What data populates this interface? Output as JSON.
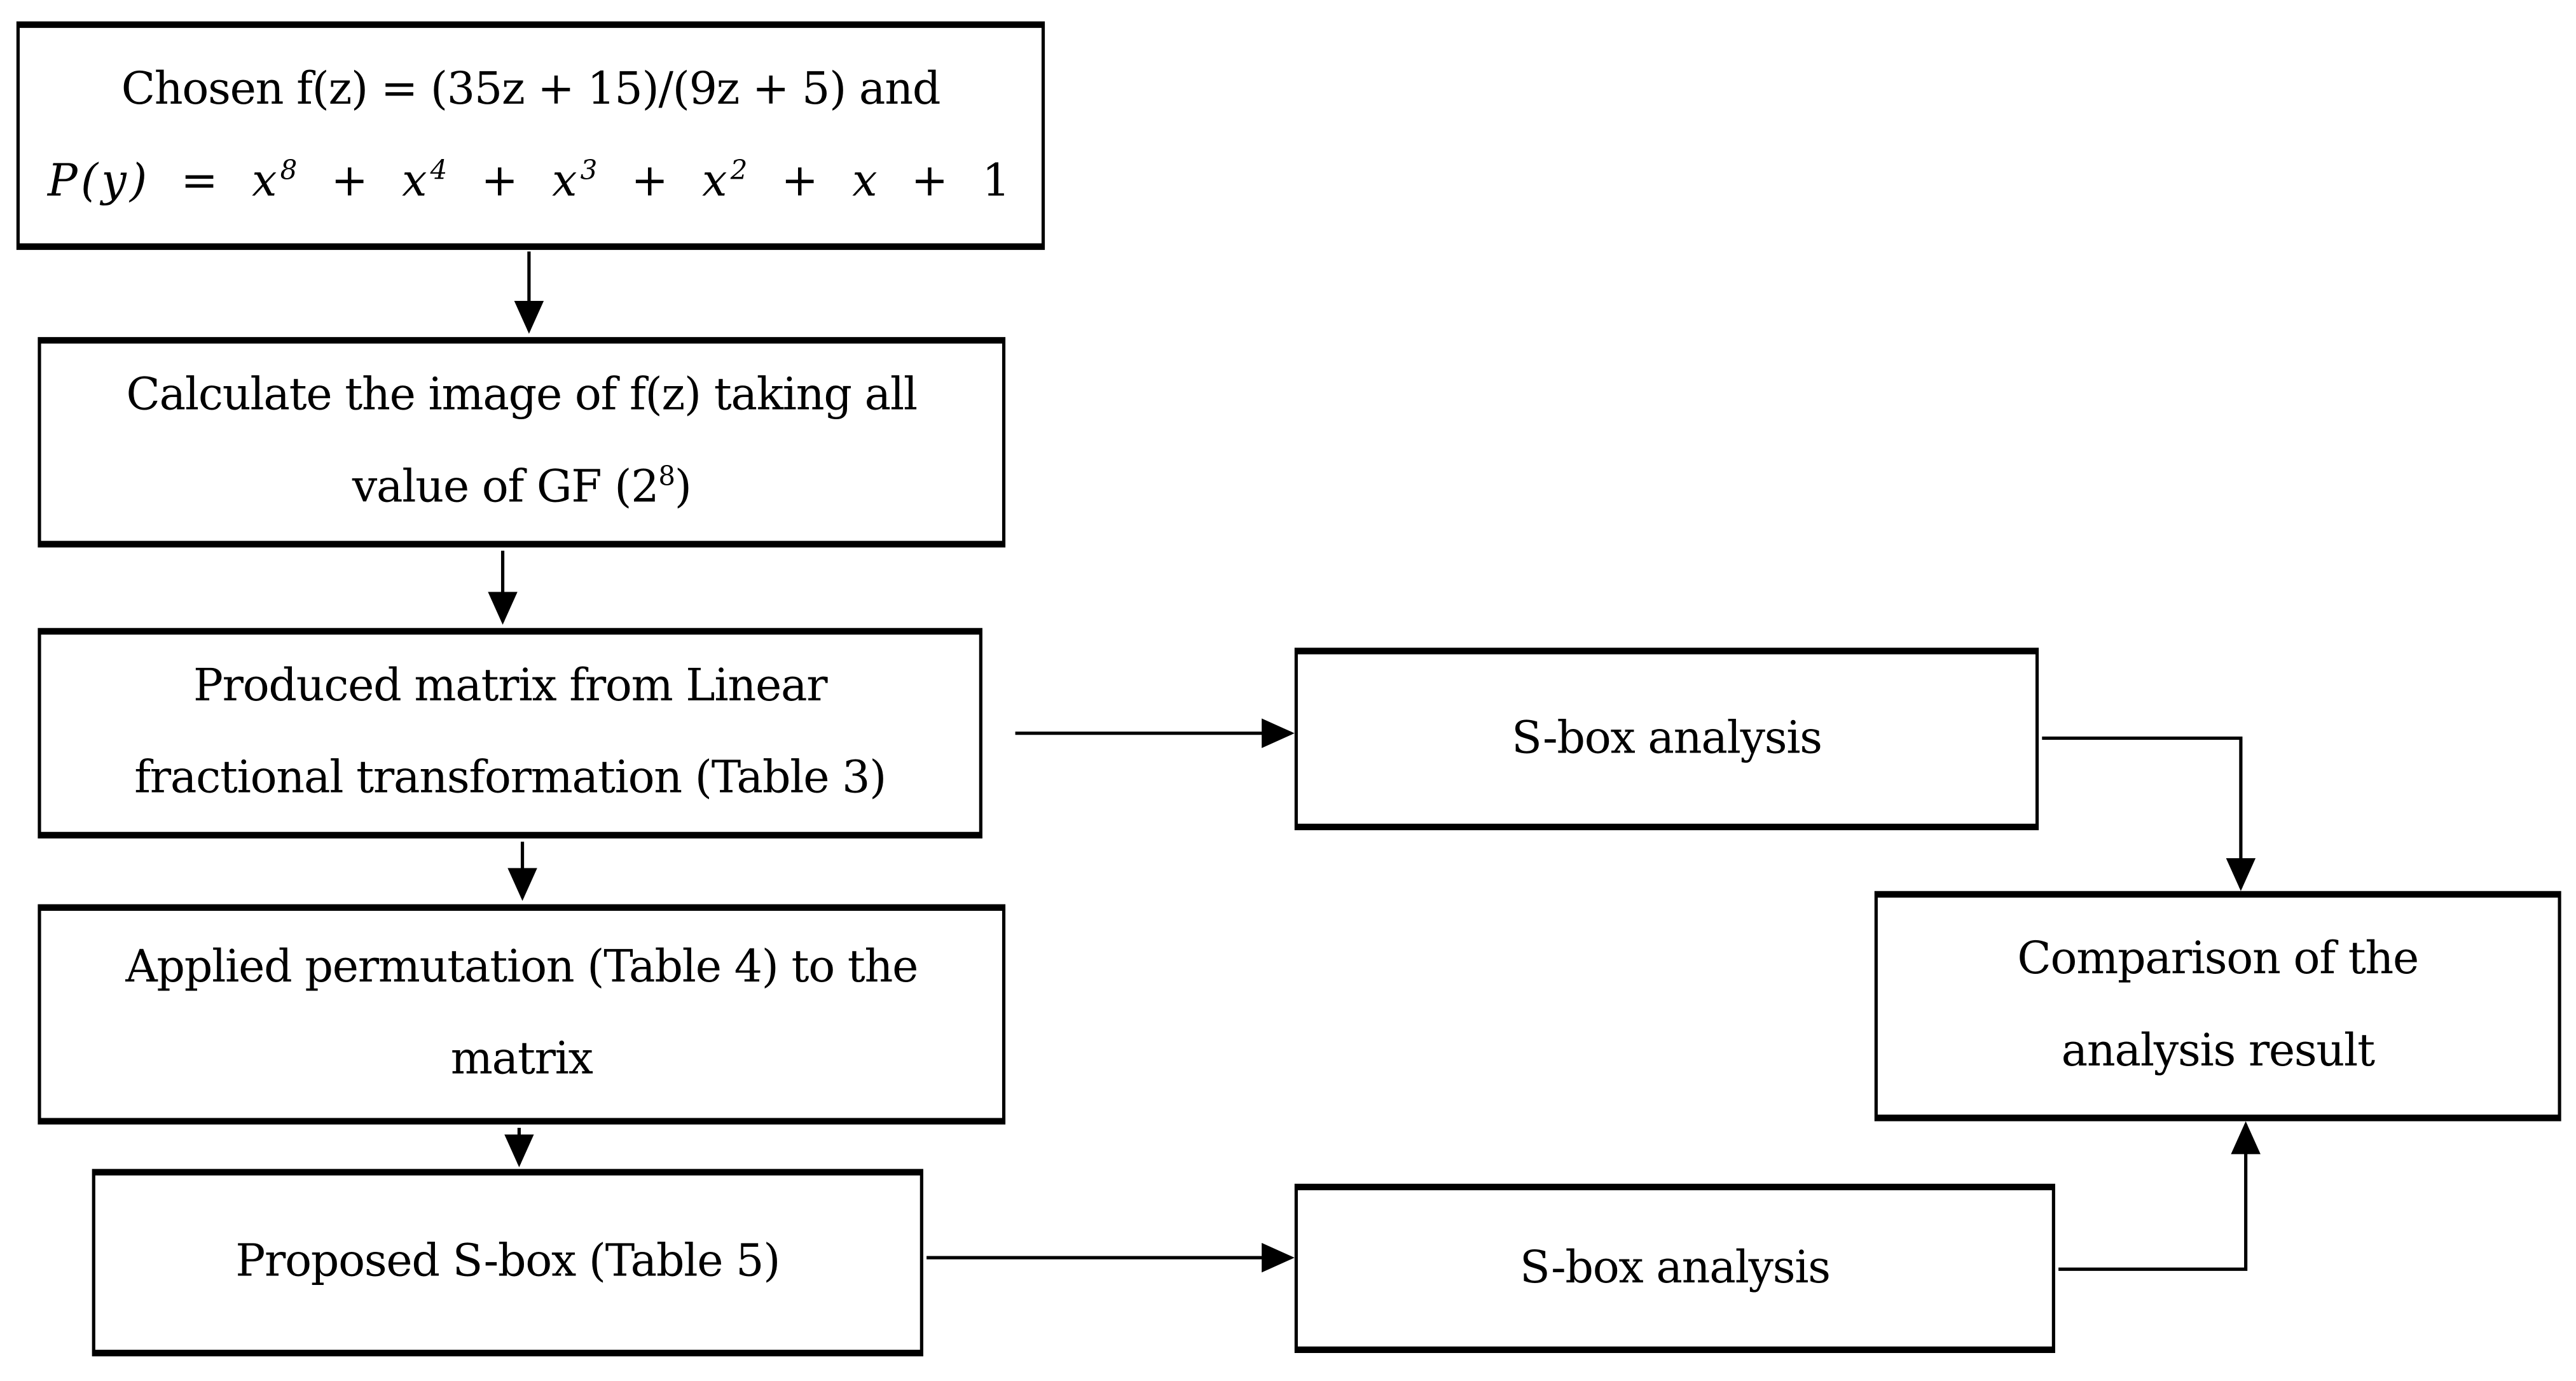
{
  "diagram": {
    "type": "flowchart",
    "nodes": {
      "start": {
        "line1": "Chosen f(z) = (35z + 15)/(9z + 5) and",
        "poly_lhs": "P(y)",
        "poly_eq": "=",
        "poly_terms": [
          {
            "base": "x",
            "exp": "8"
          },
          {
            "base": "x",
            "exp": "4"
          },
          {
            "base": "x",
            "exp": "3"
          },
          {
            "base": "x",
            "exp": "2"
          },
          {
            "base": "x",
            "exp": ""
          },
          {
            "base": "1",
            "exp": ""
          }
        ],
        "plus": "+"
      },
      "calculate": {
        "line1": "Calculate the image of f(z) taking all",
        "line2_prefix": "value of GF (2",
        "line2_exp": "8",
        "line2_suffix": ")"
      },
      "matrix": {
        "line1": "Produced matrix from Linear",
        "line2": "fractional transformation (Table 3)"
      },
      "permutation": {
        "line1": "Applied permutation (Table 4) to the",
        "line2": "matrix"
      },
      "proposed": {
        "line1": "Proposed S-box (Table 5)"
      },
      "analysis_top": {
        "line1": "S-box analysis"
      },
      "analysis_bottom": {
        "line1": "S-box analysis"
      },
      "comparison": {
        "line1": "Comparison of the",
        "line2": "analysis result"
      }
    },
    "edges": [
      {
        "from": "start",
        "to": "calculate"
      },
      {
        "from": "calculate",
        "to": "matrix"
      },
      {
        "from": "matrix",
        "to": "permutation"
      },
      {
        "from": "permutation",
        "to": "proposed"
      },
      {
        "from": "matrix",
        "to": "analysis_top"
      },
      {
        "from": "proposed",
        "to": "analysis_bottom"
      },
      {
        "from": "analysis_top",
        "to": "comparison"
      },
      {
        "from": "analysis_bottom",
        "to": "comparison"
      }
    ],
    "colors": {
      "stroke": "#000000",
      "fill": "#ffffff",
      "text": "#000000"
    }
  }
}
